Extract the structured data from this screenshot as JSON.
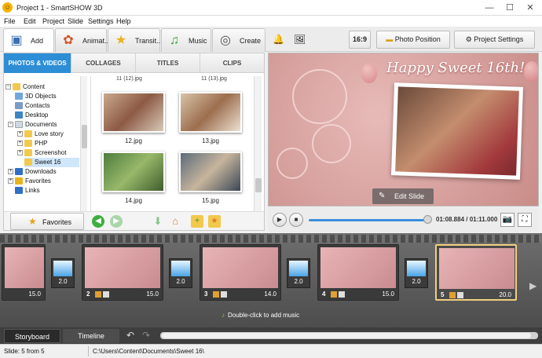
{
  "window": {
    "title": "Project 1 - SmartSHOW 3D",
    "min": "—",
    "max": "☐",
    "close": "✕"
  },
  "menu": [
    "File",
    "Edit",
    "Project",
    "Slide",
    "Settings",
    "Help"
  ],
  "toolbar": {
    "tabs": [
      {
        "label": "Add",
        "icon": "add-media-icon"
      },
      {
        "label": "Animat...",
        "icon": "palette-icon"
      },
      {
        "label": "Transit...",
        "icon": "star-icon"
      },
      {
        "label": "Music",
        "icon": "music-note-icon"
      },
      {
        "label": "Create",
        "icon": "film-reel-icon"
      }
    ],
    "aspect_label": "16:9",
    "photo_position_label": "Photo Position",
    "project_settings_label": "Project Settings"
  },
  "library": {
    "tabs": [
      "PHOTOS & VIDEOS",
      "COLLAGES",
      "TITLES",
      "CLIPS"
    ],
    "active_tab": "PHOTOS & VIDEOS",
    "tree": [
      "Content",
      "3D Objects",
      "Contacts",
      "Desktop",
      "Documents",
      "Love story",
      "PHP",
      "Screenshot",
      "Sweet 16",
      "Downloads",
      "Favorites",
      "Links"
    ],
    "selected_folder": "Sweet 16",
    "top_captions": [
      "11 (12).jpg",
      "11 (13).jpg"
    ],
    "thumbnails": [
      "12.jpg",
      "13.jpg",
      "14.jpg",
      "15.jpg"
    ],
    "favorites_label": "Favorites"
  },
  "preview": {
    "title": "Happy Sweet 16th!",
    "edit_slide_label": "Edit Slide",
    "time": "01:08.884 / 01:11.000",
    "progress": 0.97
  },
  "storyboard": {
    "slides": [
      {
        "num": "",
        "duration": "15.0"
      },
      {
        "num": "2",
        "duration": "15.0"
      },
      {
        "num": "3",
        "duration": "14.0"
      },
      {
        "num": "4",
        "duration": "15.0"
      },
      {
        "num": "5",
        "duration": "20.0"
      }
    ],
    "transitions": [
      "2.0",
      "2.0",
      "2.0",
      "2.0"
    ],
    "active_slide": 5,
    "music_hint": "Double-click to add music",
    "tabs": [
      "Storyboard",
      "Timeline"
    ]
  },
  "status": {
    "slide": "Slide: 5 from 5",
    "path": "C:\\Users\\Content\\Documents\\Sweet 16\\"
  },
  "colors": {
    "accent": "#2d8ed6",
    "slide_pink": "#d9a3a0",
    "storyboard_bg": "#4d4d4d"
  }
}
